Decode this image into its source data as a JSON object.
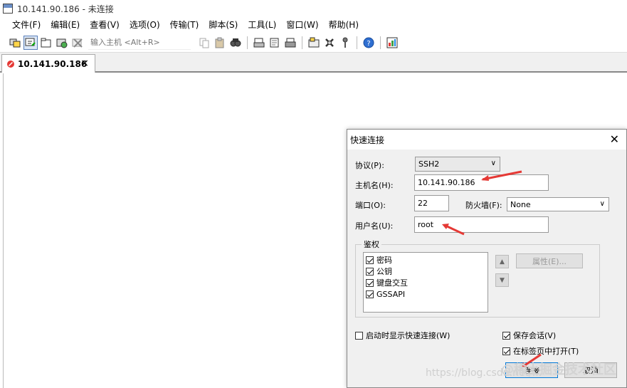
{
  "window": {
    "title": "10.141.90.186 - 未连接"
  },
  "menu": [
    "文件(F)",
    "编辑(E)",
    "查看(V)",
    "选项(O)",
    "传输(T)",
    "脚本(S)",
    "工具(L)",
    "窗口(W)",
    "帮助(H)"
  ],
  "toolbar": {
    "quick_connect_placeholder": "输入主机 <Alt+R>"
  },
  "tab": {
    "label": "10.141.90.186",
    "close": "×"
  },
  "dialog": {
    "title": "快速连接",
    "close": "✕",
    "protocol_label": "协议(P):",
    "protocol_value": "SSH2",
    "hostname_label": "主机名(H):",
    "hostname_value": "10.141.90.186",
    "port_label": "端口(O):",
    "port_value": "22",
    "firewall_label": "防火墙(F):",
    "firewall_value": "None",
    "username_label": "用户名(U):",
    "username_value": "root",
    "auth_group_label": "鉴权",
    "auth_methods": [
      {
        "label": "密码",
        "checked": true
      },
      {
        "label": "公钥",
        "checked": true
      },
      {
        "label": "键盘交互",
        "checked": true
      },
      {
        "label": "GSSAPI",
        "checked": true
      }
    ],
    "properties_button": "属性(E)...",
    "show_on_startup_label": "启动时显示快速连接(W)",
    "save_session_label": "保存会话(V)",
    "open_in_tab_label": "在标签页中打开(T)",
    "connect_button": "连接",
    "cancel_button": "取消"
  },
  "watermark": {
    "url": "https://blog.csdn.net/...",
    "brand": "@稀土掘金技术社区"
  }
}
